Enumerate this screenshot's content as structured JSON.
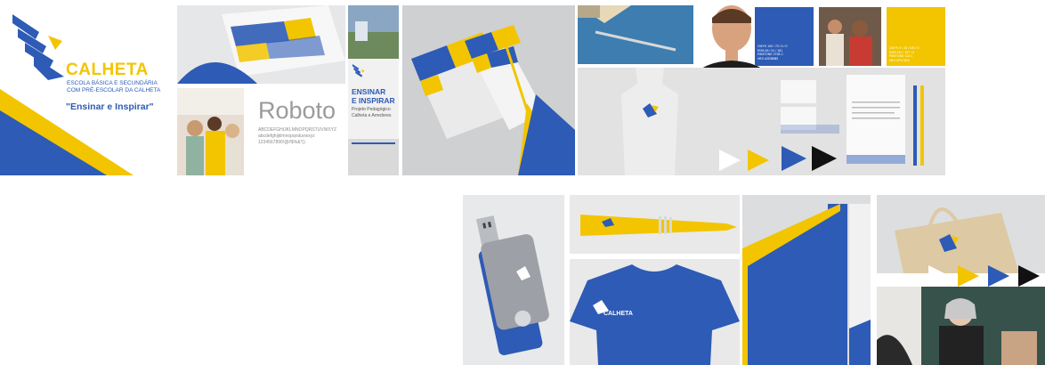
{
  "brand": {
    "name": "CALHETA",
    "subtitle_line1": "ESCOLA BÁSICA E SECUNDÁRIA",
    "subtitle_line2": "COM PRÉ-ESCOLAR DA CALHETA",
    "slogan": "\"Ensinar e Inspirar\""
  },
  "typography": {
    "font_name": "Roboto",
    "sample_line1": "ABCDEFGHIJKLMNOPQRSTUVWXYZ",
    "sample_line2": "abcdefghijklmnopqrstuvwxyz",
    "sample_line3": "1234567890!@#$%&*()"
  },
  "banner": {
    "line1": "ENSINAR",
    "line2": "E INSPIRAR",
    "line3": "Projeto Pedagógico",
    "line4": "Calheta e Arredores"
  },
  "colors": {
    "blue": "#2d5bb5",
    "yellow": "#f2c500",
    "dark": "#1d1d1d",
    "light_gray": "#e9e9ea"
  },
  "swatches": {
    "blue_label": "CMYK 100 / 70 / 0 / 0\nRGB 45 / 91 / 181\nPANTONE 2728 C\nHEX #2D5BB5",
    "yellow_label": "CMYK 0 / 15 / 100 / 0\nRGB 242 / 197 / 0\nPANTONE 116 C\nHEX #F2C500"
  },
  "icons": {
    "logo": "bird-logo-icon",
    "play_white": "play-triangle-icon",
    "play_yellow": "play-triangle-icon",
    "play_black": "play-triangle-icon"
  }
}
